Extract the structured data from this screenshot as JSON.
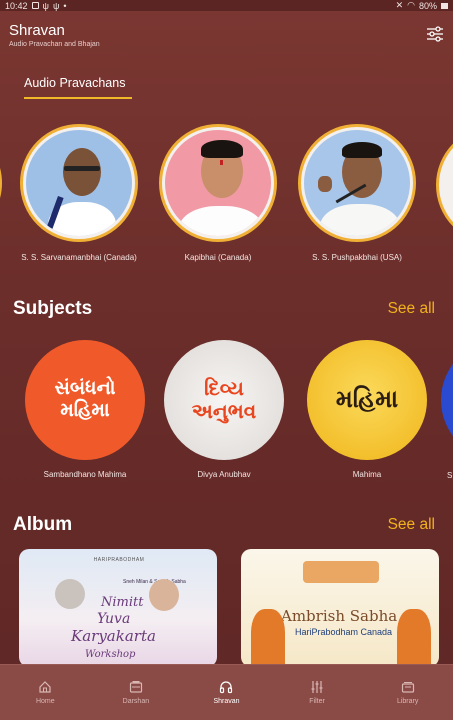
{
  "status_bar": {
    "time": "10:42",
    "battery": "80%",
    "icons": [
      "image-icon",
      "usb-icon",
      "usb-icon",
      "dot-icon",
      "mute-icon",
      "wifi-icon",
      "battery-icon"
    ]
  },
  "app": {
    "title": "Shravan",
    "subtitle": "Audio Pravachan and Bhajan",
    "filter_icon": "sliders-icon"
  },
  "tabs": [
    {
      "label": "Audio Pravachans",
      "active": true
    }
  ],
  "speakers": [
    {
      "name": "S. S. Sarvanamanbhai (Canada)",
      "photo_bg": "#9fc0e6"
    },
    {
      "name": "Kapibhai (Canada)",
      "photo_bg": "#f19aa5"
    },
    {
      "name": "S. S. Pushpakbhai (USA)",
      "photo_bg": "#a7c6ea"
    }
  ],
  "subjects_section": {
    "title": "Subjects",
    "see_all": "See all",
    "items": [
      {
        "name": "Sambandhano Mahima",
        "line1": "સંબંધનો",
        "line2": "મહિમા",
        "bg": "#f05a2a",
        "fg": "#ffffff"
      },
      {
        "name": "Divya Anubhav",
        "line1": "દિવ્ય",
        "line2": "અનુભવ",
        "bg": "#e9e6e4",
        "fg": "#e8461f"
      },
      {
        "name": "Mahima",
        "line1": "મહિમા",
        "line2": "",
        "bg": "#f5c324",
        "fg": "#2b1d14"
      }
    ]
  },
  "album_section": {
    "title": "Album",
    "see_all": "See all",
    "items": [
      {
        "brand": "HARIPRABODHAM",
        "top_text": "Sneh Milan & Samuh Sabha",
        "line1": "Nimitt",
        "line2": "Yuva",
        "line3": "Karyakarta",
        "line4": "Workshop"
      },
      {
        "title": "Ambrish Sabha",
        "subtitle": "HariPrabodham Canada"
      }
    ]
  },
  "bottom_nav": [
    {
      "label": "Home",
      "icon": "home-icon",
      "active": false
    },
    {
      "label": "Darshan",
      "icon": "darshan-icon",
      "active": false
    },
    {
      "label": "Shravan",
      "icon": "headphones-icon",
      "active": true
    },
    {
      "label": "Filter",
      "icon": "sliders-icon",
      "active": false
    },
    {
      "label": "Library",
      "icon": "library-icon",
      "active": false
    }
  ],
  "colors": {
    "background": "#6b2e2a",
    "accent": "#f2b21c",
    "nav_bg": "#8a4a46"
  }
}
